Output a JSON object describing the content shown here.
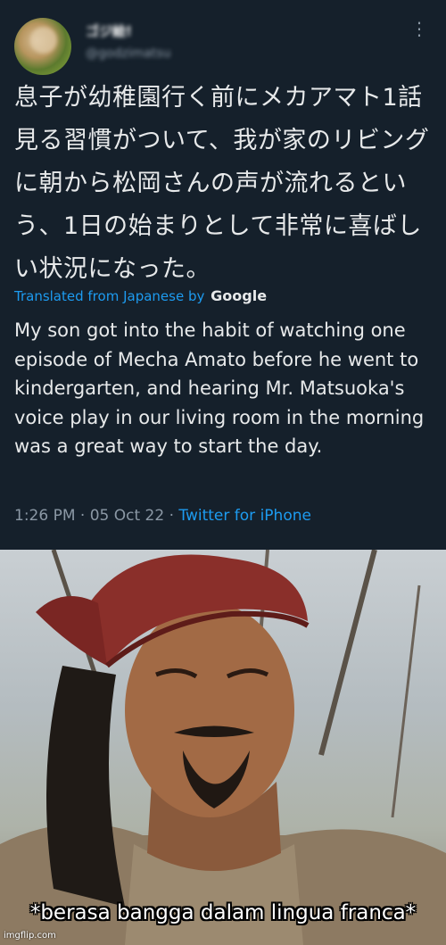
{
  "tweet": {
    "display_name": "ゴジ絵!",
    "handle": "@godzimatsu",
    "more_icon": "more-vertical-icon",
    "japanese_text": "息子が幼稚園行く前にメカアマト1話見る習慣がついて、我が家のリビングに朝から松岡さんの声が流れるという、1日の始まりとして非常に喜ばしい状況になった。",
    "translated_label": "Translated from Japanese by",
    "translator": "Google",
    "english_text": "My son got into the habit of watching one episode of Mecha Amato before he went to kindergarten, and hearing Mr. Matsuoka's voice play in our living room in the morning was a great way to start the day.",
    "time": "1:26 PM",
    "separator": "·",
    "date": "05 Oct 22",
    "source": "Twitter for iPhone",
    "colors": {
      "background": "#15202b",
      "text": "#e7e9ea",
      "link": "#1d9bf0",
      "muted": "#8b98a5"
    }
  },
  "meme": {
    "caption": "*berasa bangga dalam lingua franca*",
    "watermark": "imgflip.com"
  }
}
